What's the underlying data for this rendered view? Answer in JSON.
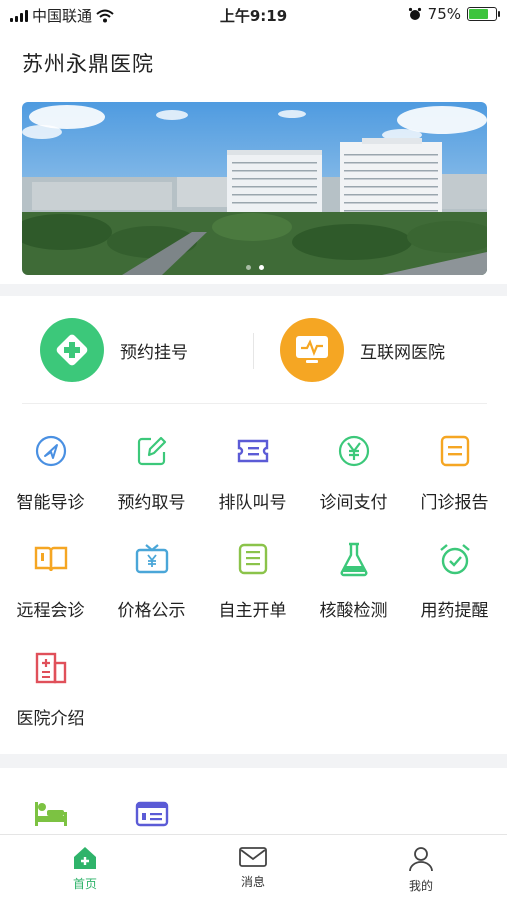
{
  "status_bar": {
    "carrier": "中国联通",
    "time": "上午9:19",
    "battery_percent": "75%",
    "battery_level": 0.75
  },
  "header": {
    "title": "苏州永鼎医院"
  },
  "banner": {
    "image_desc": "hospital building photo",
    "slides": 2,
    "active_slide": 2
  },
  "quick_actions": [
    {
      "label": "预约挂号",
      "icon": "plus-cross-icon",
      "color": "#3cc87a"
    },
    {
      "label": "互联网医院",
      "icon": "monitor-pulse-icon",
      "color": "#f5a623"
    }
  ],
  "services": [
    {
      "label": "智能导诊",
      "icon": "navigation-arrow-icon",
      "color": "#4a90e2"
    },
    {
      "label": "预约取号",
      "icon": "pencil-edit-icon",
      "color": "#3cc87a"
    },
    {
      "label": "排队叫号",
      "icon": "ticket-icon",
      "color": "#5b5bd6"
    },
    {
      "label": "诊间支付",
      "icon": "yuan-circle-icon",
      "color": "#3cc87a"
    },
    {
      "label": "门诊报告",
      "icon": "report-list-icon",
      "color": "#f5a623"
    },
    {
      "label": "远程会诊",
      "icon": "open-book-icon",
      "color": "#f5a623"
    },
    {
      "label": "价格公示",
      "icon": "price-tv-icon",
      "color": "#4aa6d8"
    },
    {
      "label": "自主开单",
      "icon": "form-sheet-icon",
      "color": "#8bc34a"
    },
    {
      "label": "核酸检测",
      "icon": "flask-icon",
      "color": "#3cc87a"
    },
    {
      "label": "用药提醒",
      "icon": "alarm-clock-icon",
      "color": "#3cc87a"
    },
    {
      "label": "医院介绍",
      "icon": "hospital-building-icon",
      "color": "#e0505a"
    }
  ],
  "more_section": [
    {
      "icon": "hospital-bed-icon",
      "color": "#7cc242"
    },
    {
      "icon": "id-card-icon",
      "color": "#5b5bd6"
    }
  ],
  "tabbar": [
    {
      "label": "首页",
      "icon": "home-icon",
      "active": true
    },
    {
      "label": "消息",
      "icon": "mail-icon",
      "active": false
    },
    {
      "label": "我的",
      "icon": "user-icon",
      "active": false
    }
  ],
  "colors": {
    "accent": "#2fb36a",
    "background_band": "#f2f3f5"
  }
}
